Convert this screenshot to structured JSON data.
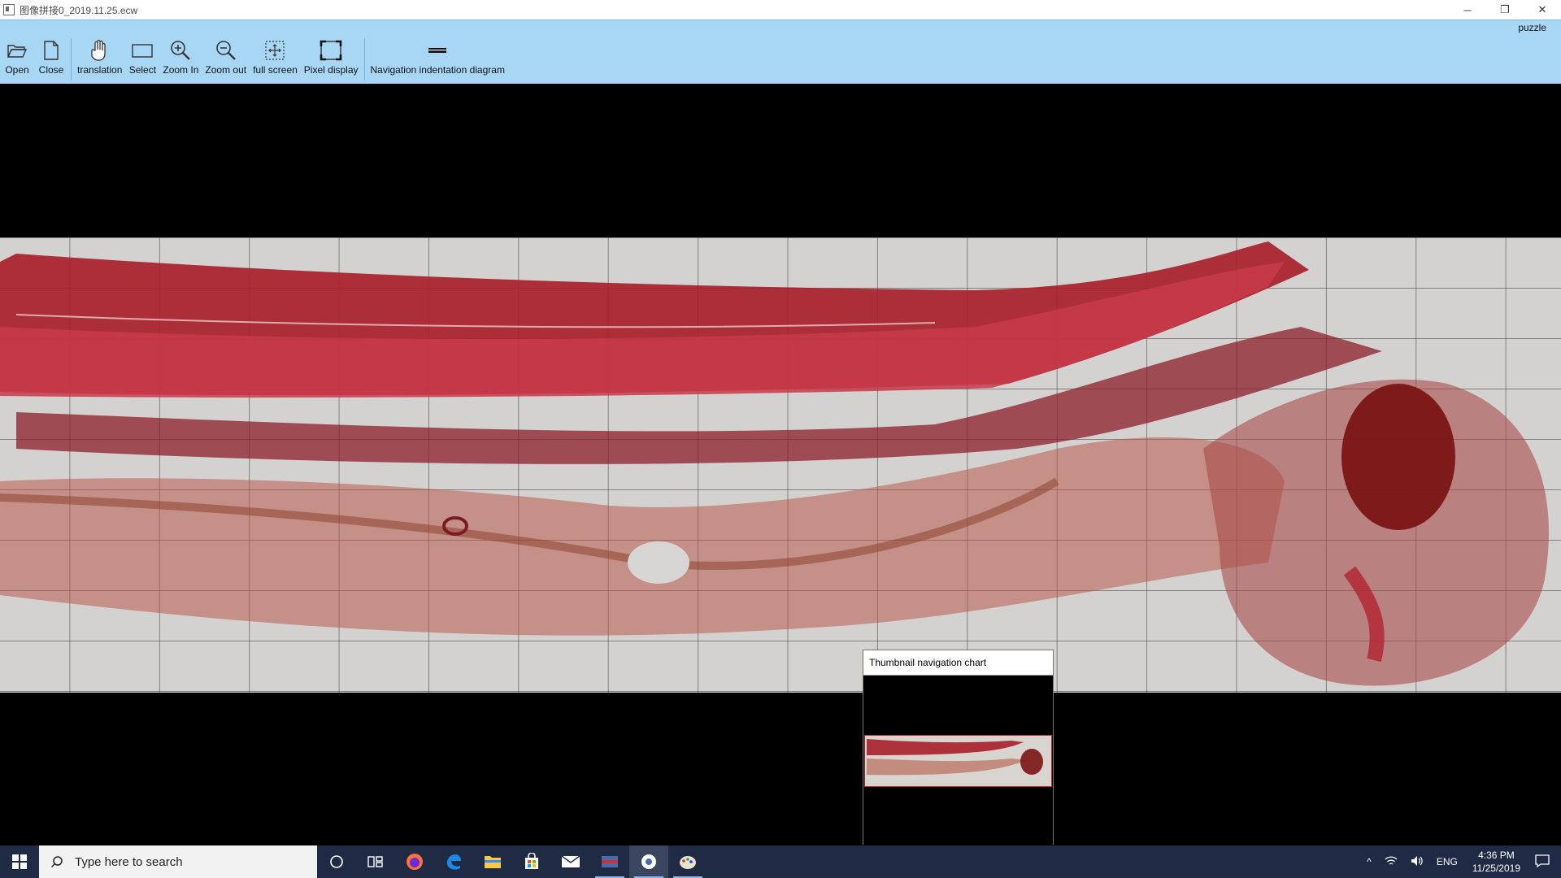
{
  "window": {
    "title": "图像拼接0_2019.11.25.ecw",
    "minimize_glyph": "─",
    "maximize_glyph": "❐",
    "close_glyph": "✕"
  },
  "ribbon": {
    "tab_label": "puzzle",
    "tools": [
      {
        "label": "Open",
        "icon": "folder-open-icon"
      },
      {
        "label": "Close",
        "icon": "document-icon"
      },
      {
        "label": "translation",
        "icon": "hand-icon"
      },
      {
        "label": "Select",
        "icon": "rectangle-select-icon"
      },
      {
        "label": "Zoom In",
        "icon": "zoom-in-icon"
      },
      {
        "label": "Zoom out",
        "icon": "zoom-out-icon"
      },
      {
        "label": "full screen",
        "icon": "full-screen-icon"
      },
      {
        "label": "Pixel display",
        "icon": "pixel-display-icon"
      },
      {
        "label": "Navigation indentation diagram",
        "icon": "navigation-thumbnail-icon"
      }
    ]
  },
  "thumbnail_panel": {
    "title": "Thumbnail navigation chart"
  },
  "taskbar": {
    "search_placeholder": "Type here to search",
    "language": "ENG",
    "time": "4:36 PM",
    "date": "11/25/2019",
    "chevron_glyph": "^"
  },
  "colors": {
    "ribbon": "#a8d7f6",
    "taskbar": "#1f2a44",
    "tissue_red": "#b3232f"
  }
}
